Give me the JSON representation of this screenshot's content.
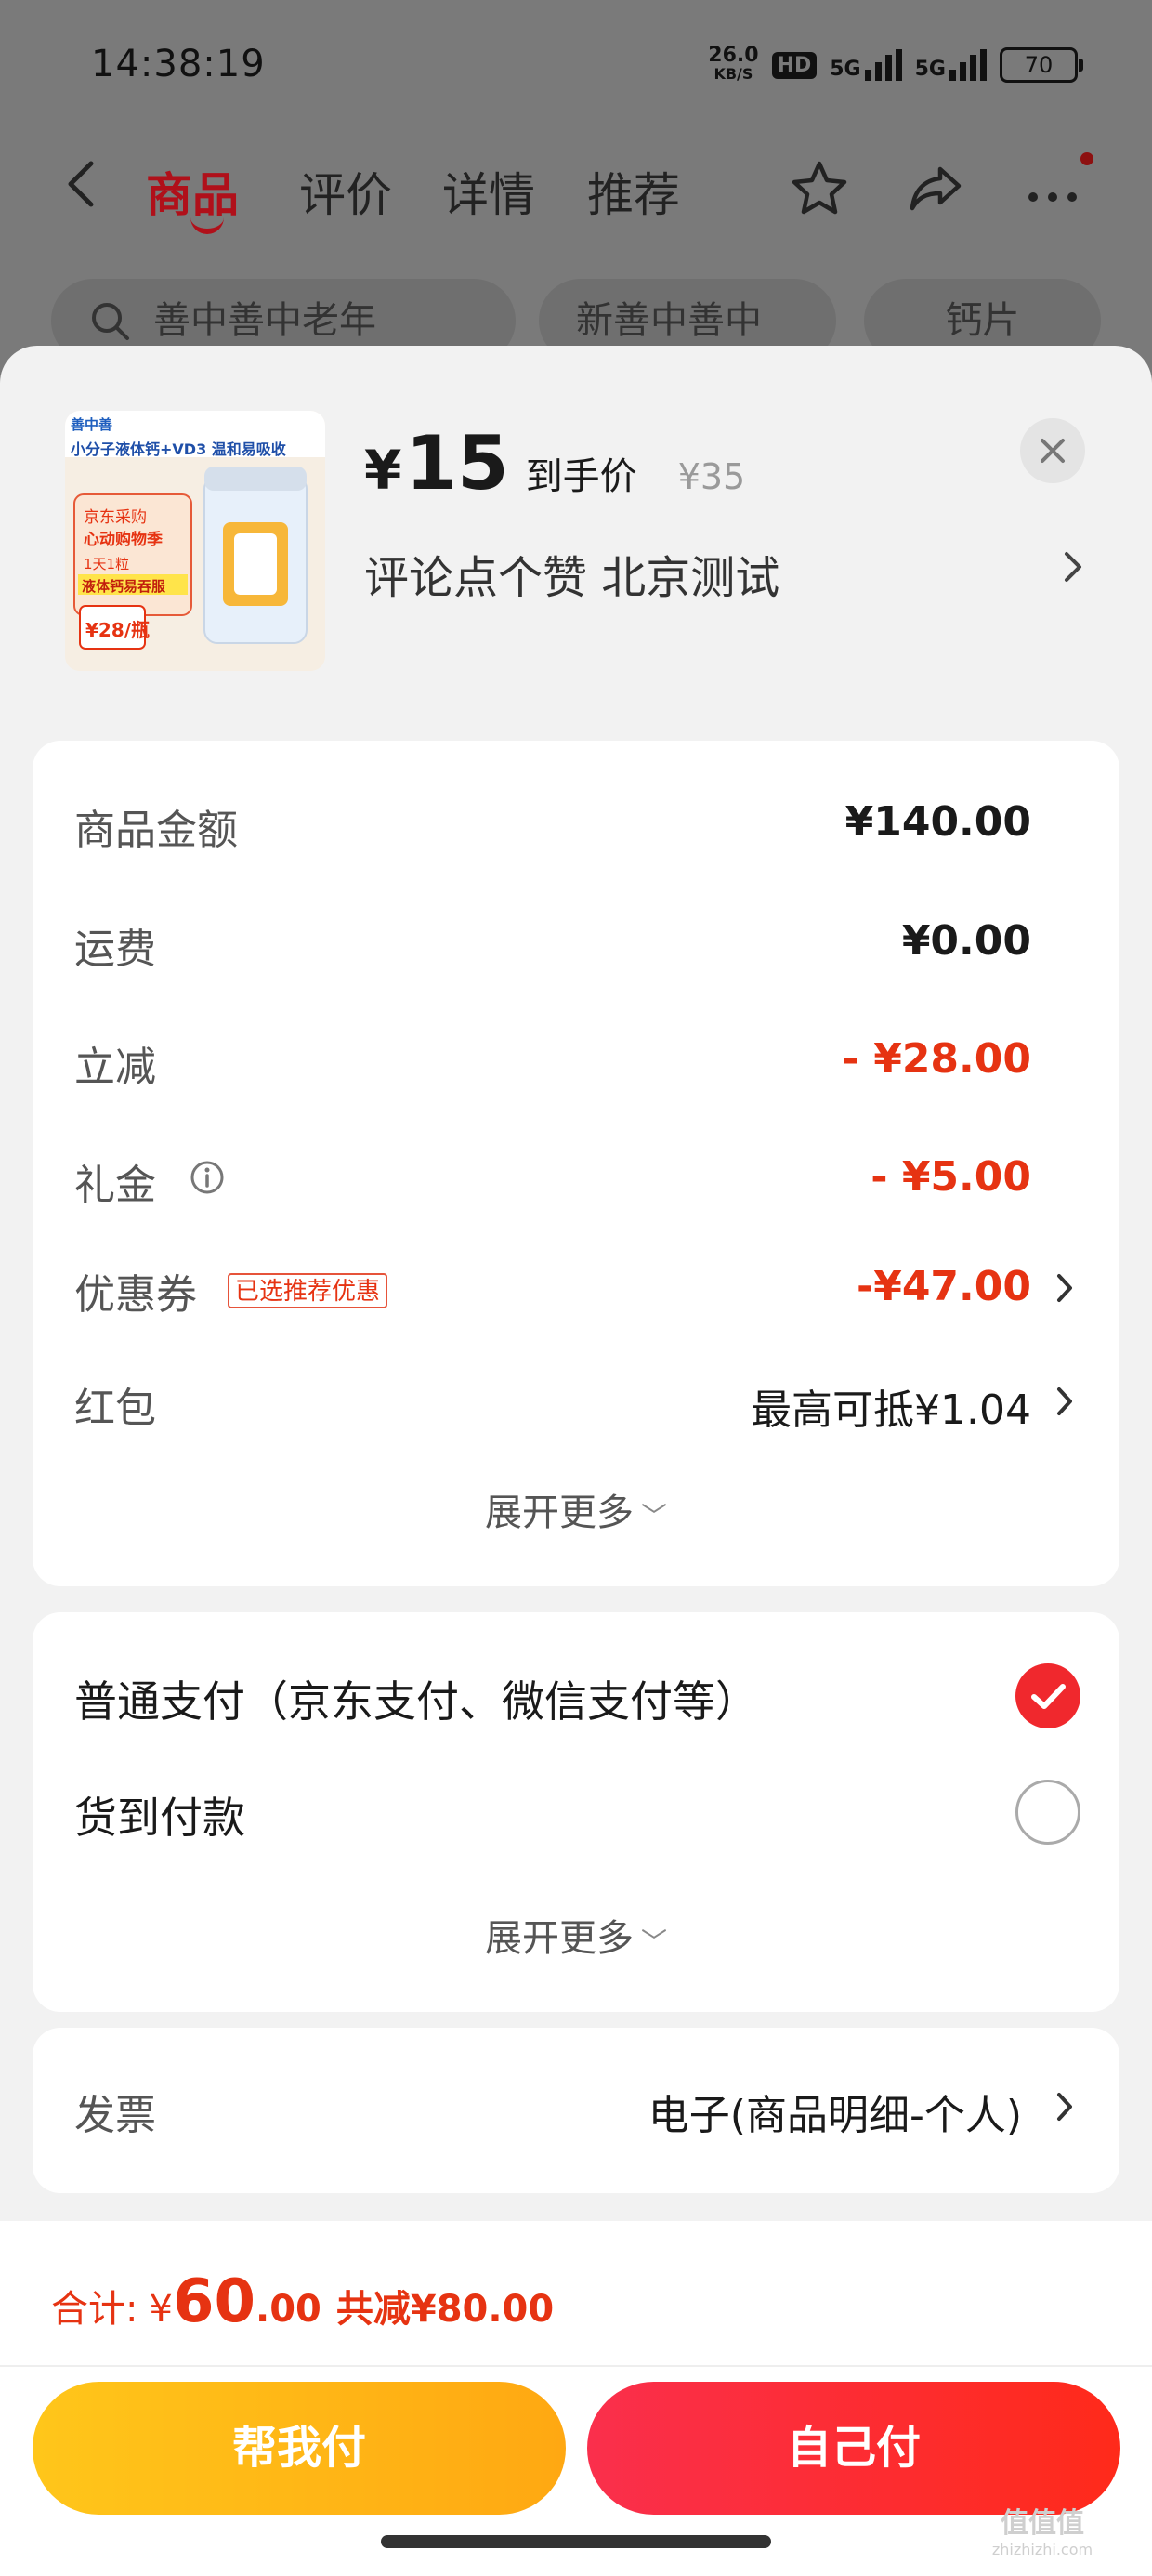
{
  "status_bar": {
    "time": "14:38:19",
    "net_speed_value": "26.0",
    "net_speed_unit": "KB/S",
    "hd_badge": "HD",
    "signal_1": "5G",
    "signal_2": "5G",
    "battery": "70"
  },
  "nav": {
    "tabs": [
      "商品",
      "评价",
      "详情",
      "推荐"
    ],
    "active_tab": "商品",
    "icons": [
      "back-icon",
      "star-icon",
      "share-icon",
      "more-icon"
    ]
  },
  "chips": [
    "善中善中老年",
    "新善中善中",
    "钙片"
  ],
  "sheet": {
    "price_symbol": "¥",
    "price": "15",
    "final_price_label": "到手价",
    "original_price": "¥35",
    "address": "评论点个赞  北京测试",
    "product_image": {
      "brand": "善中善",
      "headline": "小分子液体钙+VD3 温和易吸收",
      "promo_line_1": "京东采购",
      "promo_line_2": "心动购物季",
      "promo_line_3": "1天1粒",
      "promo_line_4": "液体钙易吞服",
      "promo_price": "¥28/瓶"
    }
  },
  "order_summary": {
    "rows": [
      {
        "label": "商品金额",
        "value": "¥140.00"
      },
      {
        "label": "运费",
        "value": "¥0.00"
      },
      {
        "label": "立减",
        "value": "- ¥28.00"
      },
      {
        "label": "礼金",
        "value": "- ¥5.00"
      },
      {
        "label": "优惠券",
        "tag": "已选推荐优惠",
        "value": "-¥47.00"
      },
      {
        "label": "红包",
        "value": "最高可抵¥1.04"
      }
    ],
    "expand_label": "展开更多"
  },
  "payment": {
    "options": [
      {
        "label": "普通支付（京东支付、微信支付等）",
        "selected": true
      },
      {
        "label": "货到付款",
        "selected": false
      }
    ],
    "expand_label": "展开更多"
  },
  "invoice": {
    "label": "发票",
    "value": "电子(商品明细-个人)"
  },
  "footer": {
    "total_label": "合计:",
    "total_symbol": "¥",
    "total_int": "60",
    "total_dec": ".00",
    "reduction": "共减¥80.00",
    "help_pay_button": "帮我付",
    "self_pay_button": "自己付"
  },
  "watermark": {
    "text": "值值值",
    "subtext": "zhizhizhi.com"
  },
  "colors": {
    "accent_red": "#e63312",
    "brand_red": "#b0101a",
    "pay_self": "#fa2f4c",
    "pay_help": "#ffb21a"
  }
}
